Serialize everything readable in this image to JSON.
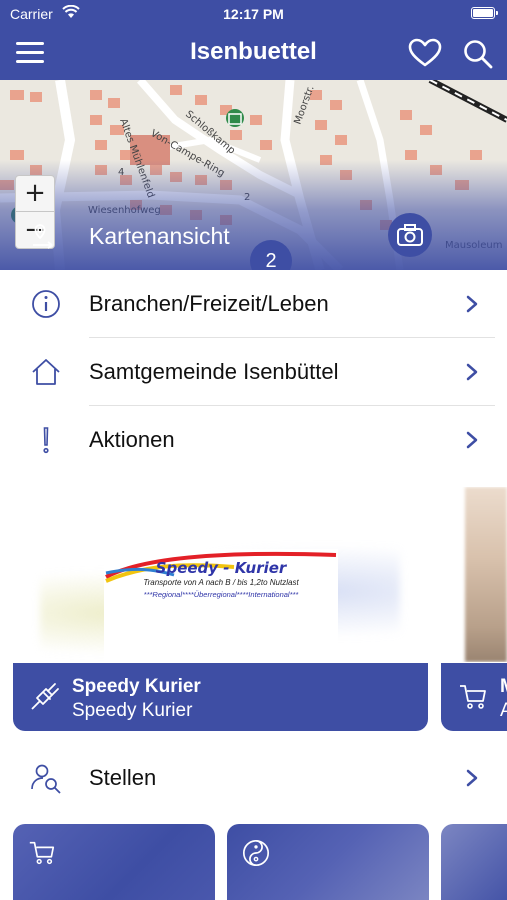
{
  "status_bar": {
    "carrier": "Carrier",
    "time": "12:17 PM"
  },
  "header": {
    "title": "Isenbuettel",
    "menu_icon": "hamburger-menu-icon",
    "favorites_icon": "heart-icon",
    "search_icon": "search-icon"
  },
  "map": {
    "label": "Kartenansicht",
    "zoom_in": "+",
    "zoom_out": "−",
    "cluster_count": "2",
    "streets": [
      "Altes Mühlenfeld",
      "Von-Campe-Ring",
      "Wiesenhofweg",
      "Moorstr.",
      "Mausoleum",
      "Schloßkamp",
      "4",
      "2"
    ]
  },
  "menu": [
    {
      "label": "Branchen/Freizeit/Leben",
      "icon": "info-circle-icon"
    },
    {
      "label": "Samtgemeinde Isenbüttel",
      "icon": "house-icon"
    },
    {
      "label": "Aktionen",
      "icon": "exclamation-icon"
    }
  ],
  "ad_banner": {
    "logo_title": "Speedy - Kurier",
    "logo_line1": "Transporte von A nach B  /  bis 1,2to Nutzlast",
    "logo_line2": "***Regional****Überregional****International***"
  },
  "ad_cards": [
    {
      "title": "Speedy Kurier",
      "subtitle": "Speedy Kurier",
      "icon": "plug-icon"
    },
    {
      "title": "M",
      "subtitle": "A",
      "icon": "shopping-cart-icon"
    }
  ],
  "stellen": {
    "label": "Stellen",
    "icon": "people-search-icon"
  },
  "tiles": [
    {
      "icon": "shopping-cart-icon"
    },
    {
      "icon": "yin-yang-icon"
    },
    {
      "icon": "tile-icon"
    }
  ],
  "colors": {
    "primary": "#3e4ea4",
    "text": "#111111",
    "divider": "#e2e2e2"
  }
}
